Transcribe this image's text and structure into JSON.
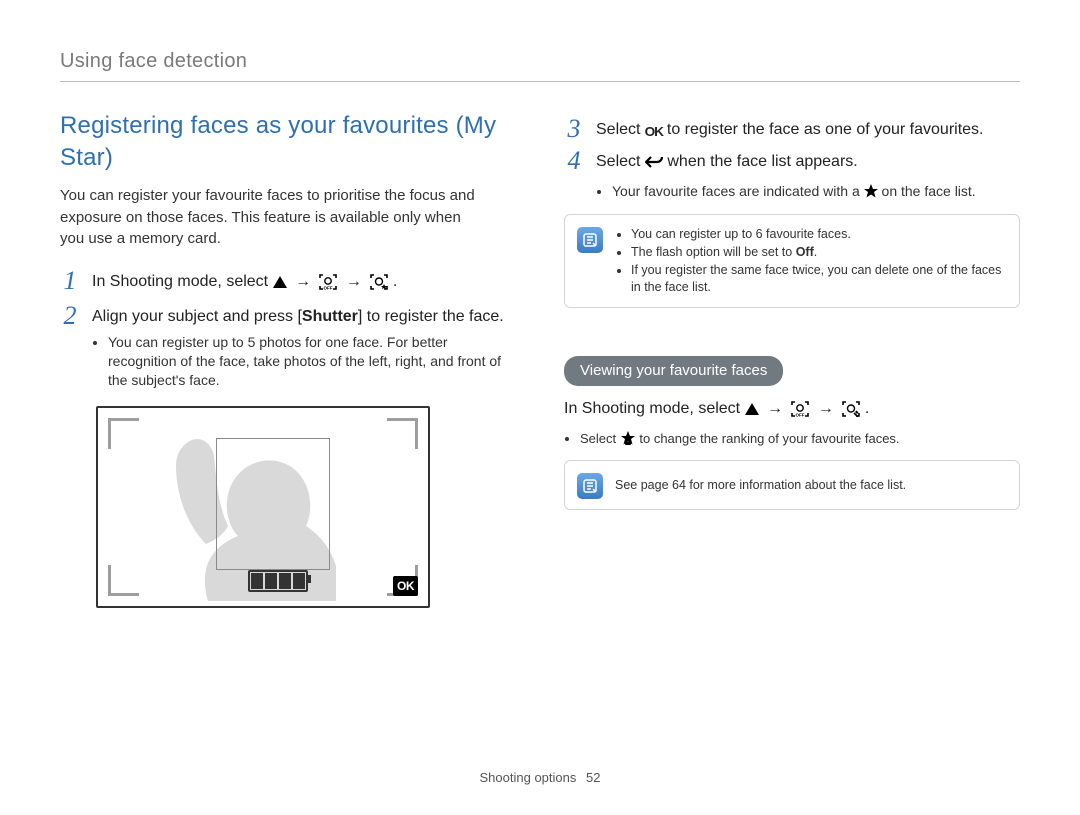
{
  "running_head": "Using face detection",
  "footer": {
    "section": "Shooting options",
    "page": "52"
  },
  "left": {
    "title": "Registering faces as your favourites (My Star)",
    "lead": "You can register your favourite faces to prioritise the focus and exposure on those faces. This feature is available only when you use a memory card.",
    "steps": {
      "s1_prefix": "In Shooting mode, select ",
      "s1_suffix": ".",
      "s2_a": "Align your subject and press [",
      "s2_bold": "Shutter",
      "s2_b": "] to register the face.",
      "s2_bullet": "You can register up to 5 photos for one face. For better recognition of the face, take photos of the left, right, and front of the subject's face."
    }
  },
  "right": {
    "s3_a": "Select ",
    "s3_b": " to register the face as one of your favourites.",
    "s4_a": "Select ",
    "s4_b": " when the face list appears.",
    "s4_bullet_a": "Your favourite faces are indicated with a ",
    "s4_bullet_b": " on the face list.",
    "note1": {
      "li1": "You can register up to 6 favourite faces.",
      "li2_a": "The flash option will be set to ",
      "li2_bold": "Off",
      "li2_b": ".",
      "li3": "If you register the same face twice, you can delete one of the faces in the face list."
    },
    "pill": "Viewing your favourite faces",
    "view_prefix": "In Shooting mode, select ",
    "view_suffix": ".",
    "view_bullet_a": "Select ",
    "view_bullet_b": " to change the ranking of your favourite faces.",
    "note2": "See page 64 for more information about the face list."
  },
  "glyphs": {
    "arrow": "→"
  },
  "chart_data": null
}
